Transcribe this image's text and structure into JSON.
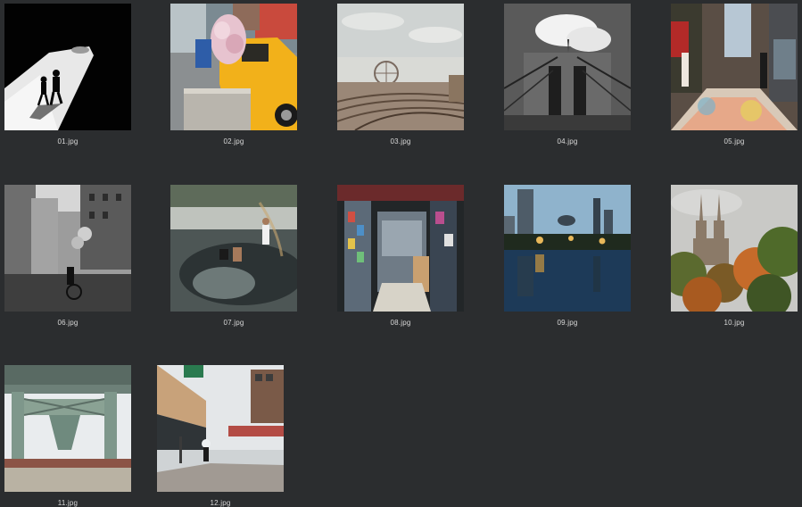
{
  "files": [
    {
      "name": "01.jpg",
      "icon": "photo-silhouettes-light-icon"
    },
    {
      "name": "02.jpg",
      "icon": "photo-yellow-taxi-icon"
    },
    {
      "name": "03.jpg",
      "icon": "photo-rail-yard-icon"
    },
    {
      "name": "04.jpg",
      "icon": "photo-brooklyn-bridge-icon"
    },
    {
      "name": "05.jpg",
      "icon": "photo-graffiti-street-icon"
    },
    {
      "name": "06.jpg",
      "icon": "photo-city-street-bw-icon"
    },
    {
      "name": "07.jpg",
      "icon": "photo-water-play-icon"
    },
    {
      "name": "08.jpg",
      "icon": "photo-market-stall-icon"
    },
    {
      "name": "09.jpg",
      "icon": "photo-skyline-reflection-icon"
    },
    {
      "name": "10.jpg",
      "icon": "photo-towers-autumn-icon"
    },
    {
      "name": "11.jpg",
      "icon": "photo-bridge-underside-icon"
    },
    {
      "name": "12.jpg",
      "icon": "photo-snowy-street-icon"
    }
  ]
}
